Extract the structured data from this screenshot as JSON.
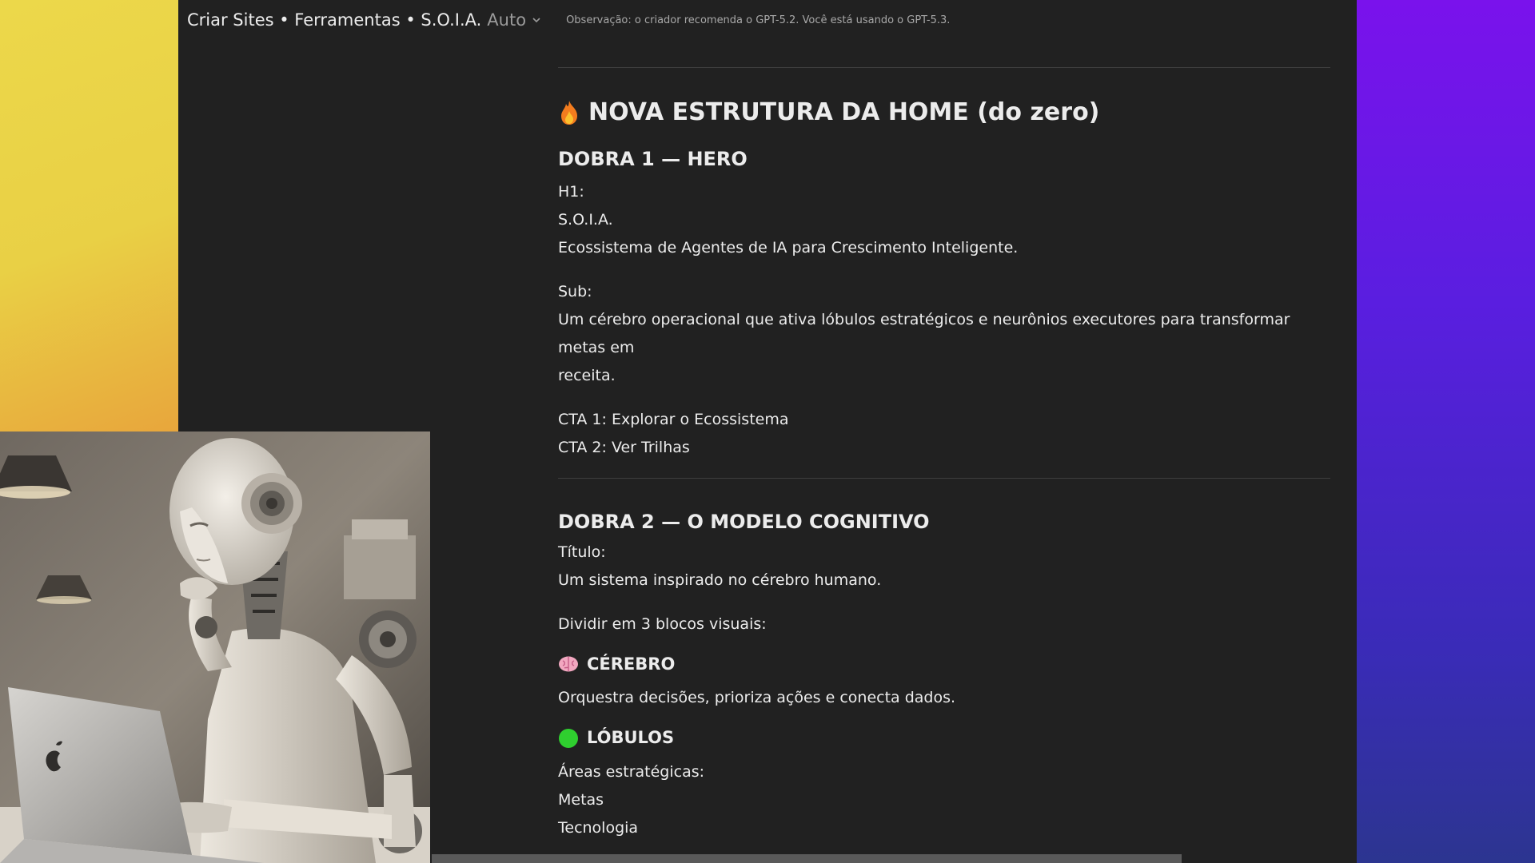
{
  "header": {
    "title": "Criar Sites • Ferramentas • S.O.I.A.",
    "mode": "Auto",
    "notice": "Observação: o criador recomenda o GPT-5.2. Você está usando o GPT-5.3."
  },
  "doc": {
    "heading": "NOVA ESTRUTURA DA HOME (do zero)",
    "heading_icon": "fire-icon",
    "s1_title": "DOBRA 1 — HERO",
    "s1_h1_label": "H1:",
    "s1_h1_l1": "S.O.I.A.",
    "s1_h1_l2": "Ecossistema de Agentes de IA para Crescimento Inteligente.",
    "s1_sub_label": "Sub:",
    "s1_sub_l1": "Um cérebro operacional que ativa lóbulos estratégicos e neurônios executores para transformar metas em",
    "s1_sub_l2": "receita.",
    "s1_cta1": "CTA 1: Explorar o Ecossistema",
    "s1_cta2": "CTA 2: Ver Trilhas",
    "s2_title": "DOBRA 2 — O MODELO COGNITIVO",
    "s2_titulo_label": "Título:",
    "s2_titulo_value": "Um sistema inspirado no cérebro humano.",
    "s2_dividir": "Dividir em 3 blocos visuais:",
    "cerebro_title": "CÉREBRO",
    "cerebro_icon": "brain-icon",
    "cerebro_desc": "Orquestra decisões, prioriza ações e conecta dados.",
    "lobulos_title": "LÓBULOS",
    "lobulos_icon": "green-circle-icon",
    "lobulos_label": "Áreas estratégicas:",
    "lobulos_items": [
      "Metas",
      "Tecnologia"
    ]
  },
  "colors": {
    "app_bg": "#212121",
    "left_gradient": "#ecd84a",
    "right_gradient": "#7a12ec",
    "green_dot": "#2fcf2f"
  }
}
